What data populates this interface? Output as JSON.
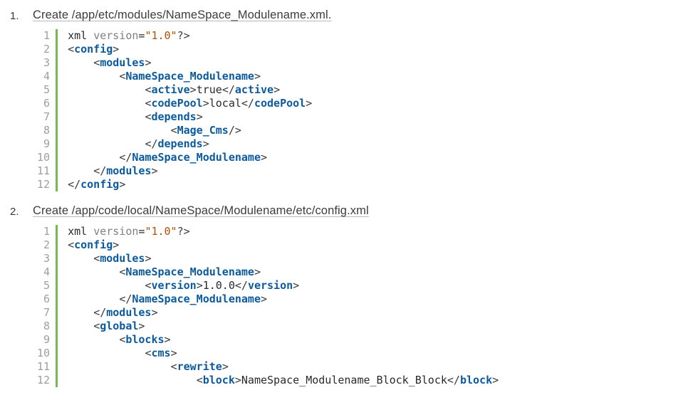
{
  "steps": [
    {
      "title": "Create /app/etc/modules/NameSpace_Modulename.xml.",
      "code": [
        [
          [
            "text",
            "xml "
          ],
          [
            "kw",
            "version"
          ],
          [
            "op",
            "="
          ],
          [
            "str",
            "\"1.0\""
          ],
          [
            "punc",
            "?>"
          ]
        ],
        [
          [
            "punc",
            "<"
          ],
          [
            "tag",
            "config"
          ],
          [
            "punc",
            ">"
          ]
        ],
        [
          [
            "text",
            "    "
          ],
          [
            "punc",
            "<"
          ],
          [
            "tag",
            "modules"
          ],
          [
            "punc",
            ">"
          ]
        ],
        [
          [
            "text",
            "        "
          ],
          [
            "punc",
            "<"
          ],
          [
            "tag",
            "NameSpace_Modulename"
          ],
          [
            "punc",
            ">"
          ]
        ],
        [
          [
            "text",
            "            "
          ],
          [
            "punc",
            "<"
          ],
          [
            "tag",
            "active"
          ],
          [
            "punc",
            ">"
          ],
          [
            "text",
            "true"
          ],
          [
            "punc",
            "</"
          ],
          [
            "tag",
            "active"
          ],
          [
            "punc",
            ">"
          ]
        ],
        [
          [
            "text",
            "            "
          ],
          [
            "punc",
            "<"
          ],
          [
            "tag",
            "codePool"
          ],
          [
            "punc",
            ">"
          ],
          [
            "text",
            "local"
          ],
          [
            "punc",
            "</"
          ],
          [
            "tag",
            "codePool"
          ],
          [
            "punc",
            ">"
          ]
        ],
        [
          [
            "text",
            "            "
          ],
          [
            "punc",
            "<"
          ],
          [
            "tag",
            "depends"
          ],
          [
            "punc",
            ">"
          ]
        ],
        [
          [
            "text",
            "                "
          ],
          [
            "punc",
            "<"
          ],
          [
            "tag",
            "Mage_Cms"
          ],
          [
            "punc",
            "/>"
          ]
        ],
        [
          [
            "text",
            "            "
          ],
          [
            "punc",
            "</"
          ],
          [
            "tag",
            "depends"
          ],
          [
            "punc",
            ">"
          ]
        ],
        [
          [
            "text",
            "        "
          ],
          [
            "punc",
            "</"
          ],
          [
            "tag",
            "NameSpace_Modulename"
          ],
          [
            "punc",
            ">"
          ]
        ],
        [
          [
            "text",
            "    "
          ],
          [
            "punc",
            "</"
          ],
          [
            "tag",
            "modules"
          ],
          [
            "punc",
            ">"
          ]
        ],
        [
          [
            "punc",
            "</"
          ],
          [
            "tag",
            "config"
          ],
          [
            "punc",
            ">"
          ]
        ]
      ]
    },
    {
      "title": "Create /app/code/local/NameSpace/Modulename/etc/config.xml",
      "code": [
        [
          [
            "text",
            "xml "
          ],
          [
            "kw",
            "version"
          ],
          [
            "op",
            "="
          ],
          [
            "str",
            "\"1.0\""
          ],
          [
            "punc",
            "?>"
          ]
        ],
        [
          [
            "punc",
            "<"
          ],
          [
            "tag",
            "config"
          ],
          [
            "punc",
            ">"
          ]
        ],
        [
          [
            "text",
            "    "
          ],
          [
            "punc",
            "<"
          ],
          [
            "tag",
            "modules"
          ],
          [
            "punc",
            ">"
          ]
        ],
        [
          [
            "text",
            "        "
          ],
          [
            "punc",
            "<"
          ],
          [
            "tag",
            "NameSpace_Modulename"
          ],
          [
            "punc",
            ">"
          ]
        ],
        [
          [
            "text",
            "            "
          ],
          [
            "punc",
            "<"
          ],
          [
            "tag",
            "version"
          ],
          [
            "punc",
            ">"
          ],
          [
            "text",
            "1.0.0"
          ],
          [
            "punc",
            "</"
          ],
          [
            "tag",
            "version"
          ],
          [
            "punc",
            ">"
          ]
        ],
        [
          [
            "text",
            "        "
          ],
          [
            "punc",
            "</"
          ],
          [
            "tag",
            "NameSpace_Modulename"
          ],
          [
            "punc",
            ">"
          ]
        ],
        [
          [
            "text",
            "    "
          ],
          [
            "punc",
            "</"
          ],
          [
            "tag",
            "modules"
          ],
          [
            "punc",
            ">"
          ]
        ],
        [
          [
            "text",
            "    "
          ],
          [
            "punc",
            "<"
          ],
          [
            "tag",
            "global"
          ],
          [
            "punc",
            ">"
          ]
        ],
        [
          [
            "text",
            "        "
          ],
          [
            "punc",
            "<"
          ],
          [
            "tag",
            "blocks"
          ],
          [
            "punc",
            ">"
          ]
        ],
        [
          [
            "text",
            "            "
          ],
          [
            "punc",
            "<"
          ],
          [
            "tag",
            "cms"
          ],
          [
            "punc",
            ">"
          ]
        ],
        [
          [
            "text",
            "                "
          ],
          [
            "punc",
            "<"
          ],
          [
            "tag",
            "rewrite"
          ],
          [
            "punc",
            ">"
          ]
        ],
        [
          [
            "text",
            "                    "
          ],
          [
            "punc",
            "<"
          ],
          [
            "tag",
            "block"
          ],
          [
            "punc",
            ">"
          ],
          [
            "text",
            "NameSpace_Modulename_Block_Block"
          ],
          [
            "punc",
            "</"
          ],
          [
            "tag",
            "block"
          ],
          [
            "punc",
            ">"
          ]
        ]
      ]
    }
  ]
}
